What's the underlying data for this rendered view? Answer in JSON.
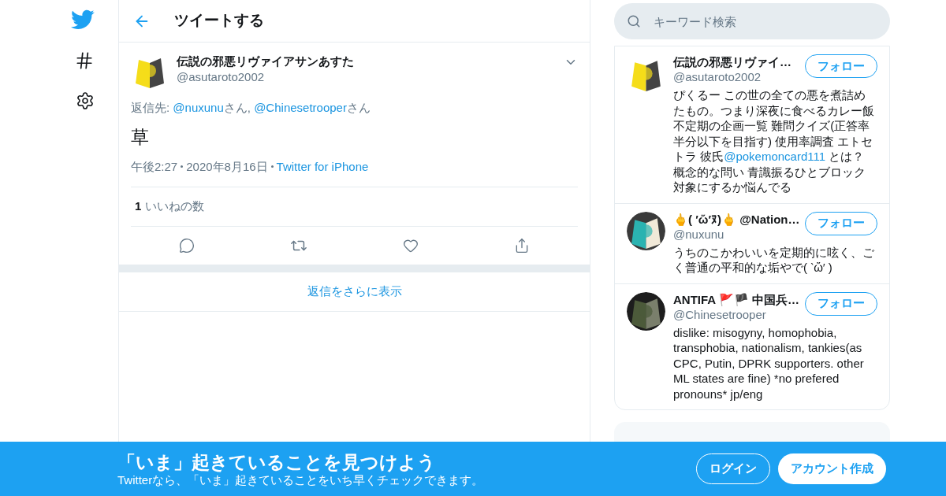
{
  "nav": {
    "items": [
      {
        "kind": "hashtag"
      },
      {
        "kind": "settings"
      }
    ]
  },
  "header": {
    "title": "ツイートする"
  },
  "tweet": {
    "name": "伝説の邪悪リヴァイアサンあすた",
    "handle": "@asutaroto2002",
    "reply_to": [
      {
        "kind": "text",
        "text": "返信先: "
      },
      {
        "kind": "mention",
        "text": "@nuxunu"
      },
      {
        "kind": "text",
        "text": "さん, "
      },
      {
        "kind": "mention",
        "text": "@Chinesetrooper"
      },
      {
        "kind": "text",
        "text": "さん"
      }
    ],
    "body": "草",
    "time": "午後2:27",
    "date": "2020年8月16日",
    "source": "Twitter for iPhone",
    "likes_count": "1",
    "likes_label": "いいねの数"
  },
  "more_replies": "返信をさらに表示",
  "search": {
    "placeholder": "キーワード検索"
  },
  "users": [
    {
      "name": "伝説の邪悪リヴァイ…",
      "handle": "@asutaroto2002",
      "follow": "フォロー",
      "bio": [
        {
          "kind": "text",
          "text": "ぴくるー この世の全ての悪を煮詰めたもの。つまり深夜に食べるカレー飯不定期の企画一覧 難問クイズ(正答率半分以下を目指す) 使用率調査 エトセトラ 彼氏"
        },
        {
          "kind": "mention",
          "text": "@pokemoncard111"
        },
        {
          "kind": "text",
          "text": " とは？概念的な問い 青識振るひとブロック対象にするか悩んでる"
        }
      ]
    },
    {
      "name": "🖕( ′ὤ′ﾇ)🖕 @Nation…",
      "handle": "@nuxunu",
      "follow": "フォロー",
      "bio": [
        {
          "kind": "text",
          "text": "うちのこかわいいを定期的に呟く、ごく普通の平和的な垢やで( ‵ὤ′ )"
        }
      ]
    },
    {
      "name": "ANTIFA 🚩🏴 中国兵…",
      "handle": "@Chinesetrooper",
      "follow": "フォロー",
      "bio": [
        {
          "kind": "text",
          "text": "dislike: misogyny, homophobia, transphobia, nationalism, tankies(as CPC, Putin, DPRK supporters. other ML states are fine) *no prefered pronouns* jp/eng"
        }
      ]
    }
  ],
  "banner": {
    "title": "「いま」起きていることを見つけよう",
    "subtitle": "Twitterなら、「いま」起きていることをいち早くチェックできます。",
    "login": "ログイン",
    "signup": "アカウント作成"
  }
}
